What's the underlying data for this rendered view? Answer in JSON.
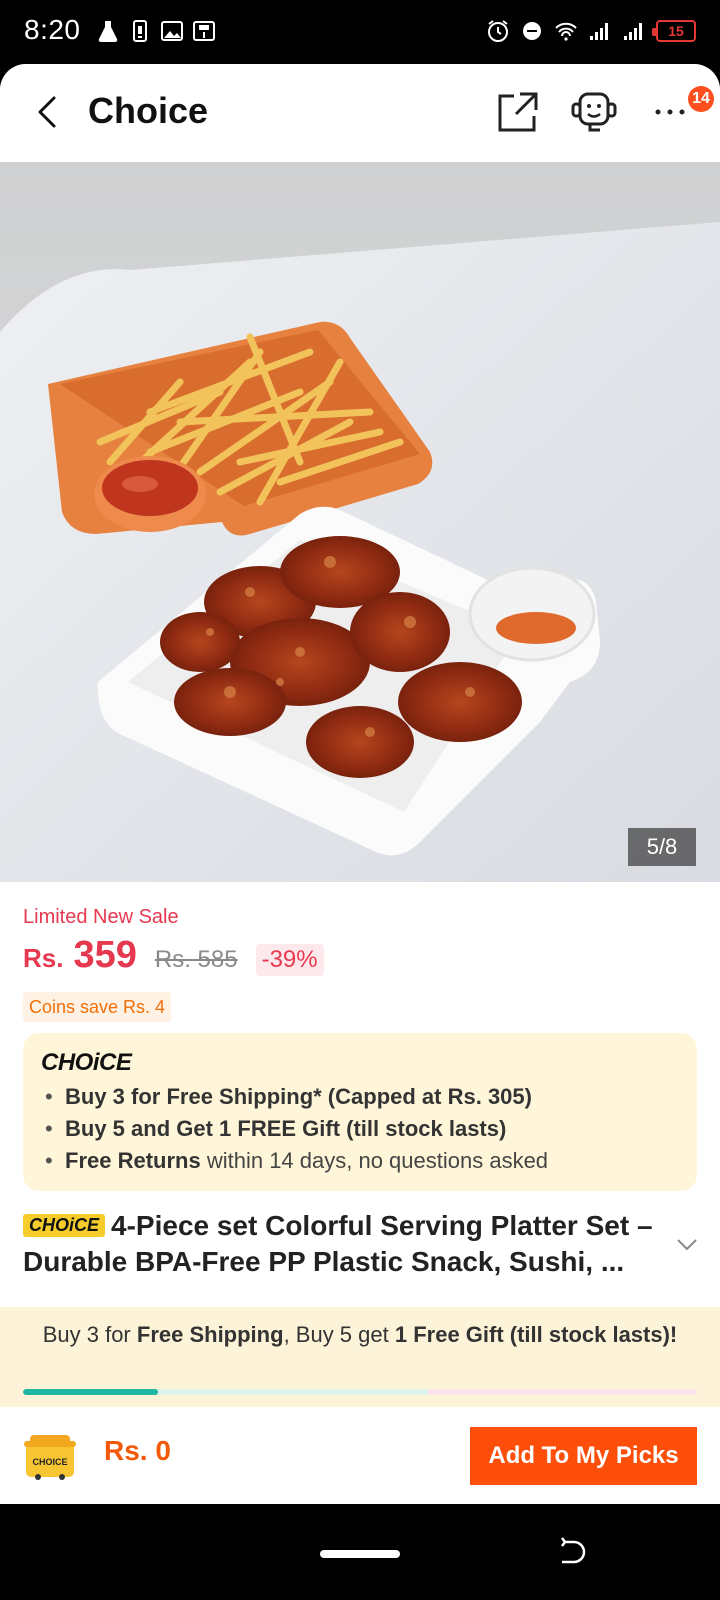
{
  "status_bar": {
    "time": "8:20",
    "battery_level": "15",
    "icons_left": [
      "flask-icon",
      "battery-saver-icon",
      "image-icon",
      "save-icon"
    ],
    "icons_right": [
      "alarm-icon",
      "dnd-icon",
      "wifi-icon",
      "signal-icon",
      "signal-icon",
      "battery-icon"
    ]
  },
  "header": {
    "title": "Choice",
    "more_badge": "14"
  },
  "gallery": {
    "counter": "5/8"
  },
  "product": {
    "sale_label": "Limited New Sale",
    "currency": "Rs.",
    "price": "359",
    "original_price": "Rs. 585",
    "discount": "-39%",
    "coins": "Coins save Rs. 4",
    "choice_logo": "CHOiCE",
    "benefits": {
      "b1_bold": "Buy 3 for  Free Shipping* (Capped at Rs. 305)",
      "b2_bold": "Buy 5 and Get 1 FREE Gift (till stock lasts)",
      "b3_bold": "Free Returns",
      "b3_rest": " within 14 days, no questions asked"
    },
    "title_tag": "CHOiCE",
    "title": "4-Piece set Colorful Serving Platter Set – Durable BPA-Free PP Plastic Snack, Sushi, ..."
  },
  "promo": {
    "p1": "Buy 3 for ",
    "p2": "Free Shipping",
    "p3": ", Buy 5 get ",
    "p4": "1 Free Gift (till stock lasts)!",
    "progress_fraction": 0.2
  },
  "bottom_bar": {
    "cart_label": "CHOICE",
    "total": "Rs. 0",
    "add_button": "Add To My Picks"
  },
  "colors": {
    "accent": "#fd4f0a",
    "price": "#e63950",
    "choice_bg": "#fff6d9",
    "progress": "#1fb5a3"
  }
}
